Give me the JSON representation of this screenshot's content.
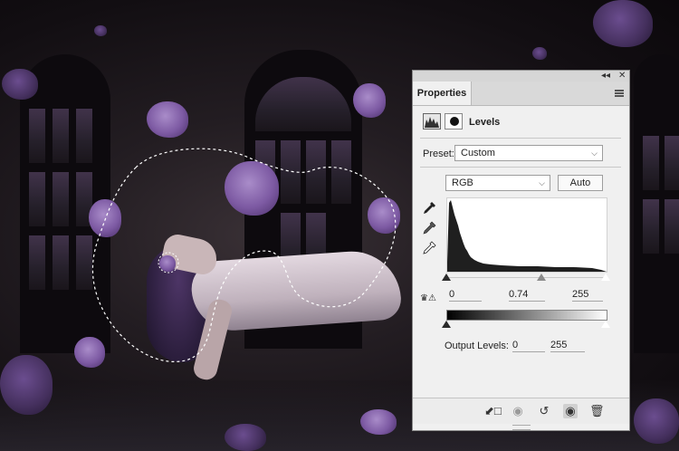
{
  "panel": {
    "collapse_glyph": "◂◂",
    "close_glyph": "✕",
    "tab_label": "Properties",
    "menu_icon": "panel-menu-icon",
    "adjustment_title": "Levels",
    "preset_label": "Preset:",
    "preset_value": "Custom",
    "channel_value": "RGB",
    "auto_label": "Auto",
    "input_black": "0",
    "input_gamma": "0.74",
    "input_white": "255",
    "output_label": "Output Levels:",
    "output_black": "0",
    "output_white": "255",
    "histogram_shape": "spike near shadows, long tail to ~205",
    "accent_colors": {
      "panel_bg": "#f0f0f0",
      "tab_bar": "#d9d9d9",
      "histogram": "#1f1f1f"
    }
  },
  "bottom_toolbar": {
    "icons": [
      "clip-to-layer-icon",
      "view-previous-state-icon",
      "reset-icon",
      "visibility-eye-icon",
      "delete-icon"
    ],
    "active": "visibility-eye-icon"
  },
  "canvas": {
    "subject": "levitating woman with purple petals and marching-ants selection"
  }
}
